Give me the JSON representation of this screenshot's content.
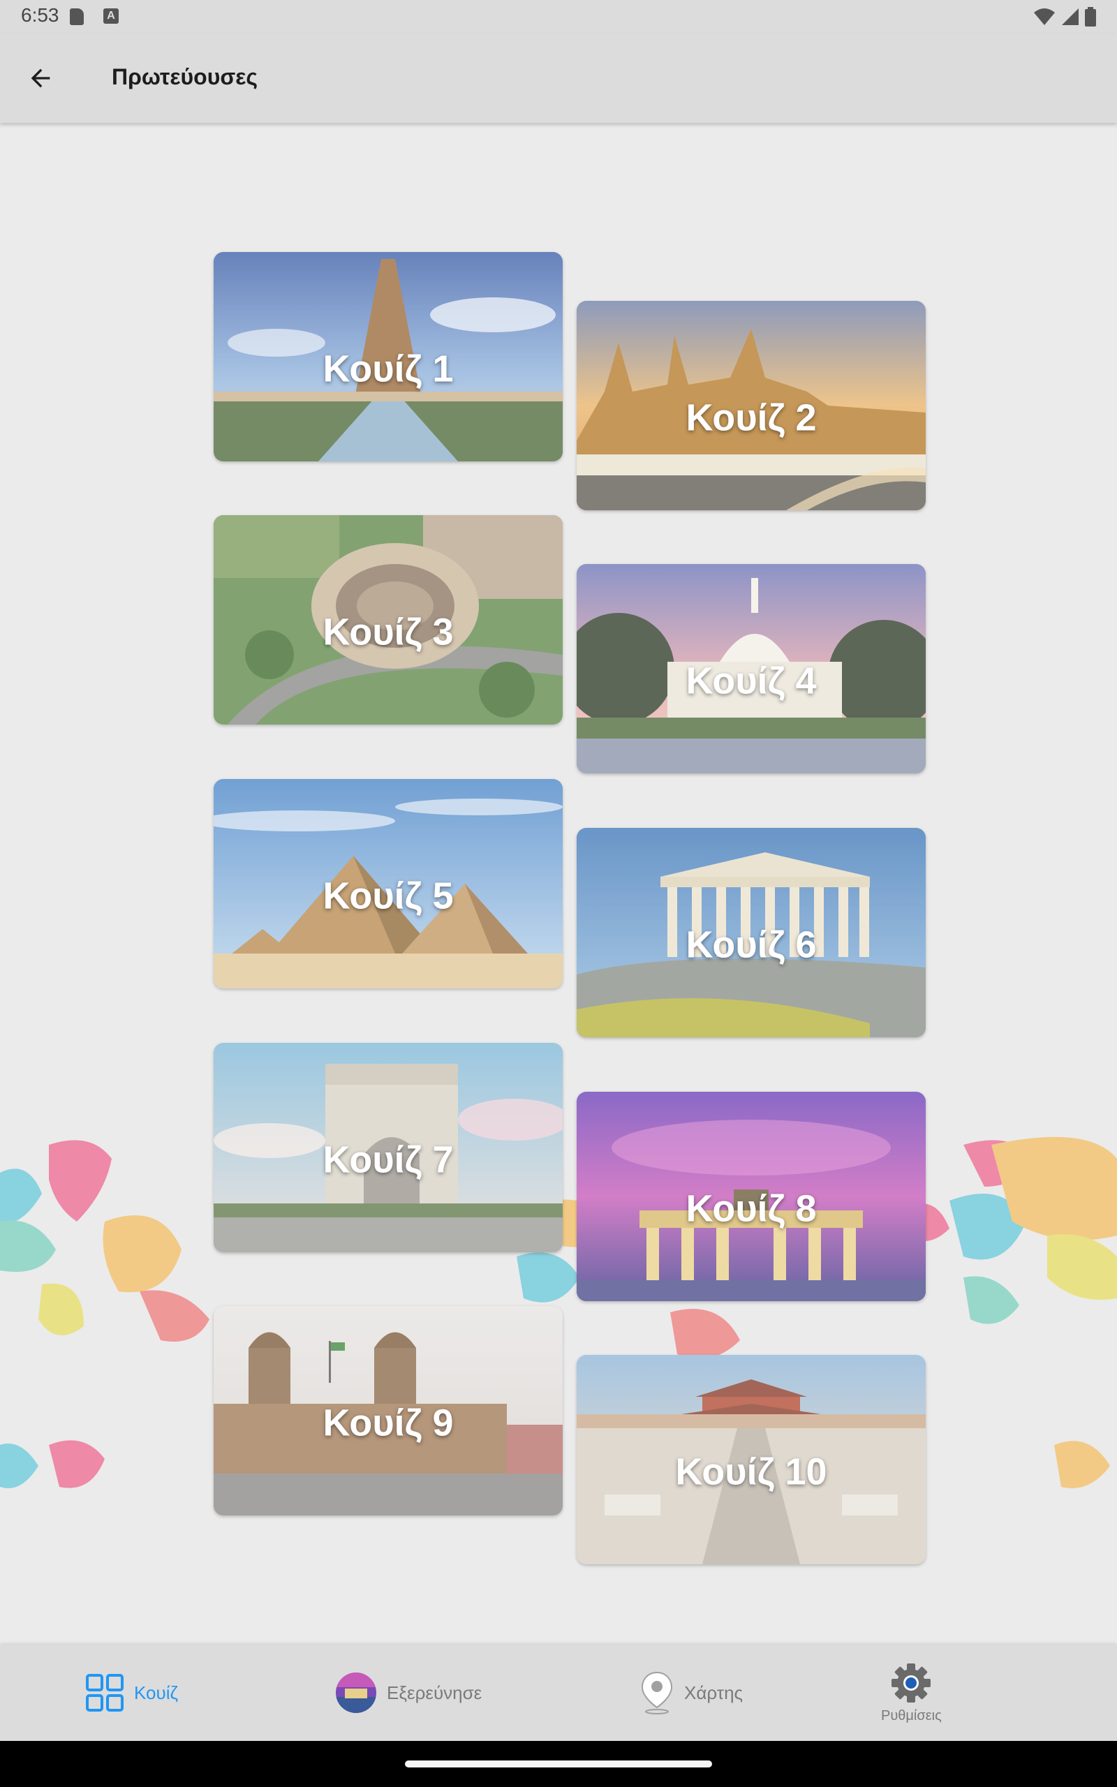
{
  "status_bar": {
    "time": "6:53",
    "indicator_a": "A"
  },
  "app_bar": {
    "title": "Πρωτεύουσες"
  },
  "quizzes": [
    {
      "label": "Κουίζ 1",
      "scene": "eiffel-tower"
    },
    {
      "label": "Κουίζ 2",
      "scene": "grand-palace-bangkok"
    },
    {
      "label": "Κουίζ 3",
      "scene": "colosseum"
    },
    {
      "label": "Κουίζ 4",
      "scene": "us-capitol"
    },
    {
      "label": "Κουίζ 5",
      "scene": "pyramids"
    },
    {
      "label": "Κουίζ 6",
      "scene": "parthenon"
    },
    {
      "label": "Κουίζ 7",
      "scene": "arc-de-triomphe"
    },
    {
      "label": "Κουίζ 8",
      "scene": "brandenburg-gate"
    },
    {
      "label": "Κουίζ 9",
      "scene": "mexico-city-cathedral"
    },
    {
      "label": "Κουίζ 10",
      "scene": "forbidden-city"
    }
  ],
  "bottom_nav": {
    "items": [
      {
        "label": "Κουίζ",
        "icon": "grid-icon",
        "active": true
      },
      {
        "label": "Εξερεύνησε",
        "icon": "explore-avatar-icon",
        "active": false
      },
      {
        "label": "Χάρτης",
        "icon": "map-pin-icon",
        "active": false
      },
      {
        "label": "Ρυθμίσεις",
        "icon": "gear-icon",
        "active": false
      }
    ]
  },
  "colors": {
    "accent": "#2196f3",
    "background": "#ebebeb",
    "bar": "#dcdcdc"
  }
}
